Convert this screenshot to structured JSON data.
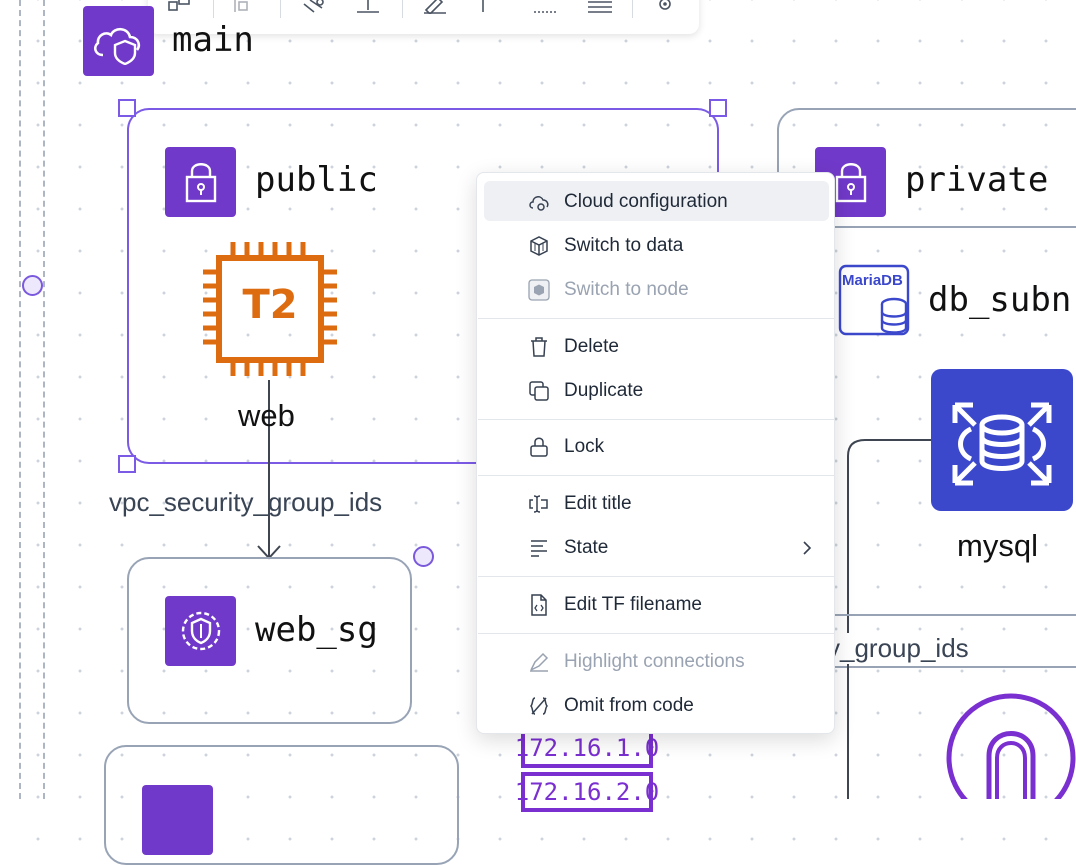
{
  "canvas": {
    "main_label": "main",
    "public_label": "public",
    "private_label": "private",
    "web_label": "web",
    "t2_text": "T2",
    "edge_label_left": "vpc_security_group_ids",
    "edge_label_right": "y_group_ids",
    "web_sg_label": "web_sg",
    "db_subnet_label": "db_subn",
    "mariadb_text": "MariaDB",
    "mysql_label": "mysql",
    "cidr_1": "172.16.1.0",
    "cidr_2": "172.16.2.0"
  },
  "context_menu": {
    "items": [
      {
        "label": "Cloud configuration",
        "icon": "cloud-gear-icon",
        "highlighted": true
      },
      {
        "label": "Switch to data",
        "icon": "box-icon"
      },
      {
        "label": "Switch to node",
        "icon": "node-icon",
        "disabled": true
      },
      {
        "label": "Delete",
        "icon": "trash-icon"
      },
      {
        "label": "Duplicate",
        "icon": "copy-icon"
      },
      {
        "label": "Lock",
        "icon": "lock-icon"
      },
      {
        "label": "Edit title",
        "icon": "text-cursor-icon"
      },
      {
        "label": "State",
        "icon": "list-icon",
        "has_submenu": true
      },
      {
        "label": "Edit TF filename",
        "icon": "file-code-icon"
      },
      {
        "label": "Highlight connections",
        "icon": "highlighter-icon",
        "disabled": true
      },
      {
        "label": "Omit from code",
        "icon": "omit-icon"
      }
    ]
  },
  "colors": {
    "accent": "#7b5be6",
    "badge_purple": "#7139c9",
    "aws_orange": "#dd6b10",
    "rds_blue": "#3b48cc"
  }
}
